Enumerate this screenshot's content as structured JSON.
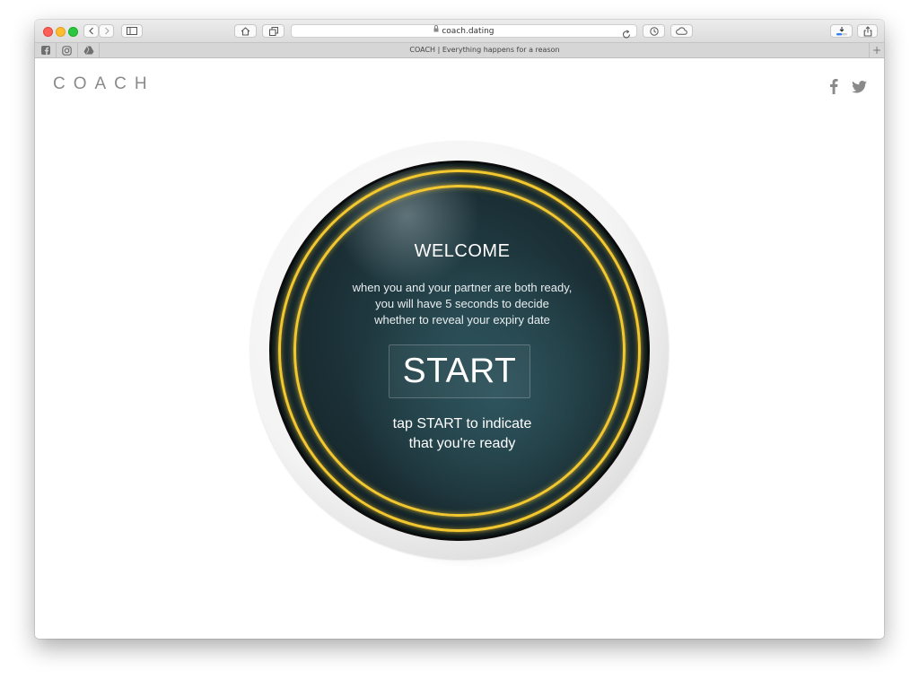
{
  "browser": {
    "url": "coach.dating",
    "tab_title": "COACH | Everything happens for a reason",
    "new_tab_label": "+",
    "pinned_tabs": [
      "facebook-icon",
      "instagram-icon",
      "drive-icon"
    ],
    "traffic_lights": {
      "close": "#fe5f57",
      "minimize": "#febc2e",
      "zoom": "#28c840"
    },
    "download_progress": 0.5
  },
  "page": {
    "logo": "COACH",
    "social": [
      "facebook-icon",
      "twitter-icon"
    ],
    "welcome": "WELCOME",
    "description": [
      "when you and your partner are both ready,",
      "you will have 5 seconds to decide",
      "whether to reveal your expiry date"
    ],
    "start_label": "START",
    "tap_hint": [
      "tap START to indicate",
      "that you're ready"
    ]
  },
  "colors": {
    "ring": "#f2c72f",
    "disc_dark": "#15262b",
    "logo": "#8a8a8a"
  }
}
